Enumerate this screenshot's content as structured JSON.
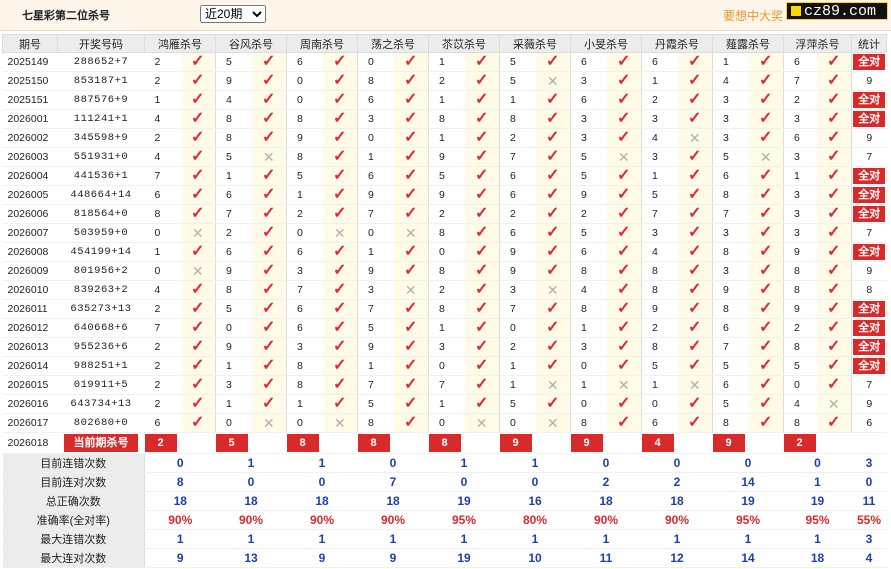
{
  "header": {
    "title": "七星彩第二位杀号",
    "period_select": "近20期",
    "promo": "要想中大奖",
    "logo": "cz89.com"
  },
  "columns": [
    "期号",
    "开奖号码",
    "鸿雁杀号",
    "谷风杀号",
    "周南杀号",
    "荡之杀号",
    "苶苡杀号",
    "采薇杀号",
    "小旻杀号",
    "丹霞杀号",
    "薤露杀号",
    "浮萍杀号",
    "统计"
  ],
  "rows": [
    {
      "issue": "2025149",
      "draw": "288652+7",
      "kills": [
        [
          2,
          1
        ],
        [
          5,
          1
        ],
        [
          6,
          1
        ],
        [
          0,
          1
        ],
        [
          1,
          1
        ],
        [
          5,
          1
        ],
        [
          6,
          1
        ],
        [
          6,
          1
        ],
        [
          1,
          1
        ],
        [
          6,
          1
        ]
      ],
      "stat": "全对"
    },
    {
      "issue": "2025150",
      "draw": "853187+1",
      "kills": [
        [
          2,
          1
        ],
        [
          9,
          1
        ],
        [
          0,
          1
        ],
        [
          8,
          1
        ],
        [
          2,
          1
        ],
        [
          5,
          0
        ],
        [
          3,
          1
        ],
        [
          1,
          1
        ],
        [
          4,
          1
        ],
        [
          7,
          1
        ]
      ],
      "stat": "9"
    },
    {
      "issue": "2025151",
      "draw": "887576+9",
      "kills": [
        [
          1,
          1
        ],
        [
          4,
          1
        ],
        [
          0,
          1
        ],
        [
          6,
          1
        ],
        [
          1,
          1
        ],
        [
          1,
          1
        ],
        [
          6,
          1
        ],
        [
          2,
          1
        ],
        [
          3,
          1
        ],
        [
          2,
          1
        ]
      ],
      "stat": "全对"
    },
    {
      "issue": "2026001",
      "draw": "111241+1",
      "kills": [
        [
          4,
          1
        ],
        [
          8,
          1
        ],
        [
          8,
          1
        ],
        [
          3,
          1
        ],
        [
          8,
          1
        ],
        [
          8,
          1
        ],
        [
          3,
          1
        ],
        [
          3,
          1
        ],
        [
          3,
          1
        ],
        [
          3,
          1
        ]
      ],
      "stat": "全对"
    },
    {
      "issue": "2026002",
      "draw": "345598+9",
      "kills": [
        [
          2,
          1
        ],
        [
          8,
          1
        ],
        [
          9,
          1
        ],
        [
          0,
          1
        ],
        [
          1,
          1
        ],
        [
          2,
          1
        ],
        [
          3,
          1
        ],
        [
          4,
          0
        ],
        [
          3,
          1
        ],
        [
          6,
          1
        ]
      ],
      "stat": "9"
    },
    {
      "issue": "2026003",
      "draw": "551931+0",
      "kills": [
        [
          4,
          1
        ],
        [
          5,
          0
        ],
        [
          8,
          1
        ],
        [
          1,
          1
        ],
        [
          9,
          1
        ],
        [
          7,
          1
        ],
        [
          5,
          0
        ],
        [
          3,
          1
        ],
        [
          5,
          0
        ],
        [
          3,
          1
        ]
      ],
      "stat": "7"
    },
    {
      "issue": "2026004",
      "draw": "441536+1",
      "kills": [
        [
          7,
          1
        ],
        [
          1,
          1
        ],
        [
          5,
          1
        ],
        [
          6,
          1
        ],
        [
          5,
          1
        ],
        [
          6,
          1
        ],
        [
          5,
          1
        ],
        [
          1,
          1
        ],
        [
          6,
          1
        ],
        [
          1,
          1
        ]
      ],
      "stat": "全对"
    },
    {
      "issue": "2026005",
      "draw": "448664+14",
      "kills": [
        [
          6,
          1
        ],
        [
          6,
          1
        ],
        [
          1,
          1
        ],
        [
          9,
          1
        ],
        [
          9,
          1
        ],
        [
          6,
          1
        ],
        [
          9,
          1
        ],
        [
          5,
          1
        ],
        [
          8,
          1
        ],
        [
          3,
          1
        ]
      ],
      "stat": "全对"
    },
    {
      "issue": "2026006",
      "draw": "818564+0",
      "kills": [
        [
          8,
          1
        ],
        [
          7,
          1
        ],
        [
          2,
          1
        ],
        [
          7,
          1
        ],
        [
          2,
          1
        ],
        [
          2,
          1
        ],
        [
          2,
          1
        ],
        [
          7,
          1
        ],
        [
          7,
          1
        ],
        [
          3,
          1
        ]
      ],
      "stat": "全对"
    },
    {
      "issue": "2026007",
      "draw": "503959+0",
      "kills": [
        [
          0,
          0
        ],
        [
          2,
          1
        ],
        [
          0,
          0
        ],
        [
          0,
          0
        ],
        [
          8,
          1
        ],
        [
          6,
          1
        ],
        [
          5,
          1
        ],
        [
          3,
          1
        ],
        [
          3,
          1
        ],
        [
          3,
          1
        ]
      ],
      "stat": "7"
    },
    {
      "issue": "2026008",
      "draw": "454199+14",
      "kills": [
        [
          1,
          1
        ],
        [
          6,
          1
        ],
        [
          6,
          1
        ],
        [
          1,
          1
        ],
        [
          0,
          1
        ],
        [
          9,
          1
        ],
        [
          6,
          1
        ],
        [
          4,
          1
        ],
        [
          8,
          1
        ],
        [
          9,
          1
        ]
      ],
      "stat": "全对"
    },
    {
      "issue": "2026009",
      "draw": "801956+2",
      "kills": [
        [
          0,
          0
        ],
        [
          9,
          1
        ],
        [
          3,
          1
        ],
        [
          9,
          1
        ],
        [
          8,
          1
        ],
        [
          9,
          1
        ],
        [
          8,
          1
        ],
        [
          8,
          1
        ],
        [
          3,
          1
        ],
        [
          8,
          1
        ]
      ],
      "stat": "9"
    },
    {
      "issue": "2026010",
      "draw": "839263+2",
      "kills": [
        [
          4,
          1
        ],
        [
          8,
          1
        ],
        [
          7,
          1
        ],
        [
          3,
          0
        ],
        [
          2,
          1
        ],
        [
          3,
          0
        ],
        [
          4,
          1
        ],
        [
          8,
          1
        ],
        [
          9,
          1
        ],
        [
          8,
          1
        ]
      ],
      "stat": "8"
    },
    {
      "issue": "2026011",
      "draw": "635273+13",
      "kills": [
        [
          2,
          1
        ],
        [
          5,
          1
        ],
        [
          6,
          1
        ],
        [
          7,
          1
        ],
        [
          8,
          1
        ],
        [
          7,
          1
        ],
        [
          8,
          1
        ],
        [
          9,
          1
        ],
        [
          8,
          1
        ],
        [
          9,
          1
        ]
      ],
      "stat": "全对"
    },
    {
      "issue": "2026012",
      "draw": "640668+6",
      "kills": [
        [
          7,
          1
        ],
        [
          0,
          1
        ],
        [
          6,
          1
        ],
        [
          5,
          1
        ],
        [
          1,
          1
        ],
        [
          0,
          1
        ],
        [
          1,
          1
        ],
        [
          2,
          1
        ],
        [
          6,
          1
        ],
        [
          2,
          1
        ]
      ],
      "stat": "全对"
    },
    {
      "issue": "2026013",
      "draw": "955236+6",
      "kills": [
        [
          2,
          1
        ],
        [
          9,
          1
        ],
        [
          3,
          1
        ],
        [
          9,
          1
        ],
        [
          3,
          1
        ],
        [
          2,
          1
        ],
        [
          3,
          1
        ],
        [
          8,
          1
        ],
        [
          7,
          1
        ],
        [
          8,
          1
        ]
      ],
      "stat": "全对"
    },
    {
      "issue": "2026014",
      "draw": "988251+1",
      "kills": [
        [
          2,
          1
        ],
        [
          1,
          1
        ],
        [
          8,
          1
        ],
        [
          1,
          1
        ],
        [
          0,
          1
        ],
        [
          1,
          1
        ],
        [
          0,
          1
        ],
        [
          5,
          1
        ],
        [
          5,
          1
        ],
        [
          5,
          1
        ]
      ],
      "stat": "全对"
    },
    {
      "issue": "2026015",
      "draw": "019911+5",
      "kills": [
        [
          2,
          1
        ],
        [
          3,
          1
        ],
        [
          8,
          1
        ],
        [
          7,
          1
        ],
        [
          7,
          1
        ],
        [
          1,
          0
        ],
        [
          1,
          0
        ],
        [
          1,
          0
        ],
        [
          6,
          1
        ],
        [
          0,
          1
        ]
      ],
      "stat": "7"
    },
    {
      "issue": "2026016",
      "draw": "643734+13",
      "kills": [
        [
          2,
          1
        ],
        [
          1,
          1
        ],
        [
          1,
          1
        ],
        [
          5,
          1
        ],
        [
          1,
          1
        ],
        [
          5,
          1
        ],
        [
          0,
          1
        ],
        [
          0,
          1
        ],
        [
          5,
          1
        ],
        [
          4,
          0
        ]
      ],
      "stat": "9"
    },
    {
      "issue": "2026017",
      "draw": "802680+0",
      "kills": [
        [
          6,
          1
        ],
        [
          0,
          0
        ],
        [
          0,
          0
        ],
        [
          8,
          1
        ],
        [
          0,
          0
        ],
        [
          0,
          0
        ],
        [
          8,
          1
        ],
        [
          6,
          1
        ],
        [
          8,
          1
        ],
        [
          8,
          1
        ]
      ],
      "stat": "6"
    }
  ],
  "current": {
    "issue": "2026018",
    "label": "当前期杀号",
    "kills": [
      "2",
      "5",
      "8",
      "8",
      "8",
      "9",
      "9",
      "4",
      "9",
      "2"
    ]
  },
  "stats": [
    {
      "label": "目前连错次数",
      "vals": [
        "0",
        "1",
        "1",
        "0",
        "1",
        "1",
        "0",
        "0",
        "0",
        "0",
        "3"
      ],
      "red": false
    },
    {
      "label": "目前连对次数",
      "vals": [
        "8",
        "0",
        "0",
        "7",
        "0",
        "0",
        "2",
        "2",
        "14",
        "1",
        "0"
      ],
      "red": false
    },
    {
      "label": "总正确次数",
      "vals": [
        "18",
        "18",
        "18",
        "18",
        "19",
        "16",
        "18",
        "18",
        "19",
        "19",
        "11"
      ],
      "red": false
    },
    {
      "label": "准确率(全对率)",
      "vals": [
        "90%",
        "90%",
        "90%",
        "90%",
        "95%",
        "80%",
        "90%",
        "90%",
        "95%",
        "95%",
        "55%"
      ],
      "red": true
    },
    {
      "label": "最大连错次数",
      "vals": [
        "1",
        "1",
        "1",
        "1",
        "1",
        "1",
        "1",
        "1",
        "1",
        "1",
        "3"
      ],
      "red": false
    },
    {
      "label": "最大连对次数",
      "vals": [
        "9",
        "13",
        "9",
        "9",
        "19",
        "10",
        "11",
        "12",
        "14",
        "18",
        "4"
      ],
      "red": false
    }
  ],
  "colors": {
    "accent": "#d82a2a",
    "stat_blue": "#1a3fb3",
    "promo": "#e69a2a",
    "header_bg": "#ececec"
  }
}
